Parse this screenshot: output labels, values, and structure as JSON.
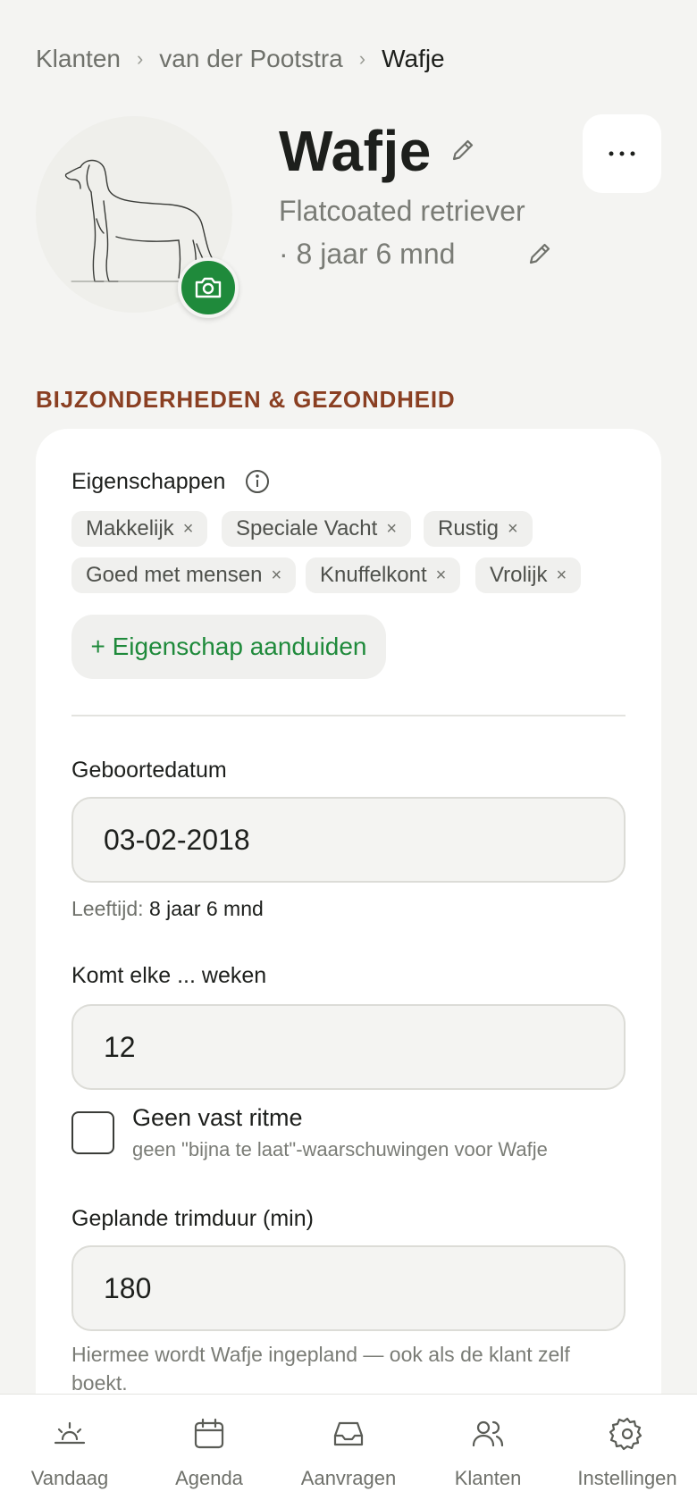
{
  "breadcrumb": {
    "items": [
      "Klanten",
      "van der Pootstra",
      "Wafje"
    ]
  },
  "pet": {
    "name": "Wafje",
    "breed_age": "Flatcoated retriever · 8 jaar 6 mnd"
  },
  "section": {
    "title": "BIJZONDERHEDEN & GEZONDHEID"
  },
  "traits": {
    "label": "Eigenschappen",
    "chips": [
      "Makkelijk",
      "Speciale Vacht",
      "Rustig",
      "Goed met mensen",
      "Knuffelkont",
      "Vrolijk"
    ],
    "remove_glyph": "×",
    "add_label": "+ Eigenschap aanduiden"
  },
  "birthdate": {
    "label": "Geboortedatum",
    "value": "03-02-2018",
    "age_prefix": "Leeftijd:",
    "age_value": "8 jaar 6 mnd"
  },
  "interval": {
    "label": "Komt elke ... weken",
    "value": "12"
  },
  "no_rhythm": {
    "title": "Geen vast ritme",
    "subtitle": "geen \"bijna te laat\"-waarschuwingen voor Wafje",
    "checked": false
  },
  "duration": {
    "label": "Geplande trimduur (min)",
    "value": "180",
    "footnote": "Hiermee wordt Wafje ingepland — ook als de klant zelf boekt."
  },
  "nav": {
    "items": [
      {
        "label": "Vandaag",
        "icon": "sunrise-icon"
      },
      {
        "label": "Agenda",
        "icon": "calendar-icon"
      },
      {
        "label": "Aanvragen",
        "icon": "inbox-icon"
      },
      {
        "label": "Klanten",
        "icon": "users-icon"
      },
      {
        "label": "Instellingen",
        "icon": "gear-icon"
      }
    ]
  },
  "colors": {
    "accent_green": "#1f8a3b",
    "section_brown": "#8a3f22",
    "background": "#f4f4f2"
  }
}
